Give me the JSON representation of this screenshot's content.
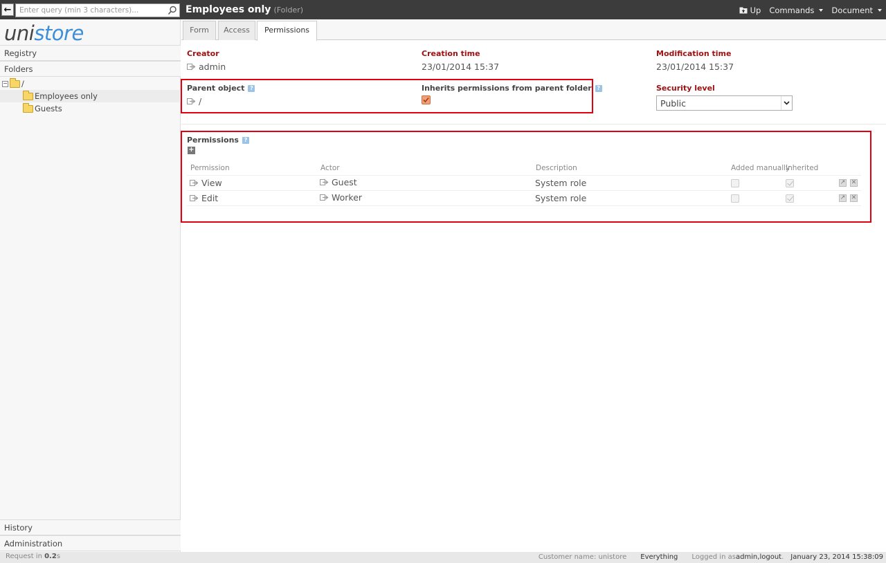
{
  "topbar": {
    "search_placeholder": "Enter query (min 3 characters)...",
    "title": "Employees only",
    "title_type": "(Folder)",
    "nav": {
      "up": "Up",
      "commands": "Commands",
      "document": "Document"
    }
  },
  "sidebar": {
    "logo_uni": "uni",
    "logo_store": "store",
    "registry": "Registry",
    "folders": "Folders",
    "tree": {
      "root": "/",
      "employees": "Employees only",
      "guests": "Guests"
    },
    "history": "History",
    "administration": "Administration"
  },
  "tabs": {
    "form": "Form",
    "access": "Access",
    "permissions": "Permissions"
  },
  "fields": {
    "creator_label": "Creator",
    "creator_value": "admin",
    "creation_time_label": "Creation time",
    "creation_time_value": "23/01/2014 15:37",
    "modification_time_label": "Modification time",
    "modification_time_value": "23/01/2014 15:37",
    "parent_object_label": "Parent object",
    "parent_object_value": "/",
    "inherits_label": "Inherits permissions from parent folder",
    "inherits_checked": true,
    "security_level_label": "Security level",
    "security_level_value": "Public",
    "help": "?"
  },
  "permissions": {
    "title": "Permissions",
    "add": "+",
    "headers": {
      "permission": "Permission",
      "actor": "Actor",
      "description": "Description",
      "added_manually": "Added manually",
      "inherited": "Inherited"
    },
    "rows": [
      {
        "permission": "View",
        "actor": "Guest",
        "description": "System role",
        "added_manually": false,
        "inherited": true
      },
      {
        "permission": "Edit",
        "actor": "Worker",
        "description": "System role",
        "added_manually": false,
        "inherited": true
      }
    ]
  },
  "footer": {
    "request_prefix": "Request in ",
    "request_time": "0.2",
    "request_suffix": "s",
    "customer": "Customer name: unistore",
    "everything": "Everything",
    "logged_in_prefix": "Logged in as ",
    "user": "admin",
    "sep": " , ",
    "logout": "logout",
    "dot": ".",
    "datetime": "January 23, 2014 15:38:09"
  },
  "colors": {
    "accent_red": "#a01010",
    "highlight": "#e00010",
    "logo_blue": "#3e8ed8",
    "topbar": "#3c3c3c"
  }
}
